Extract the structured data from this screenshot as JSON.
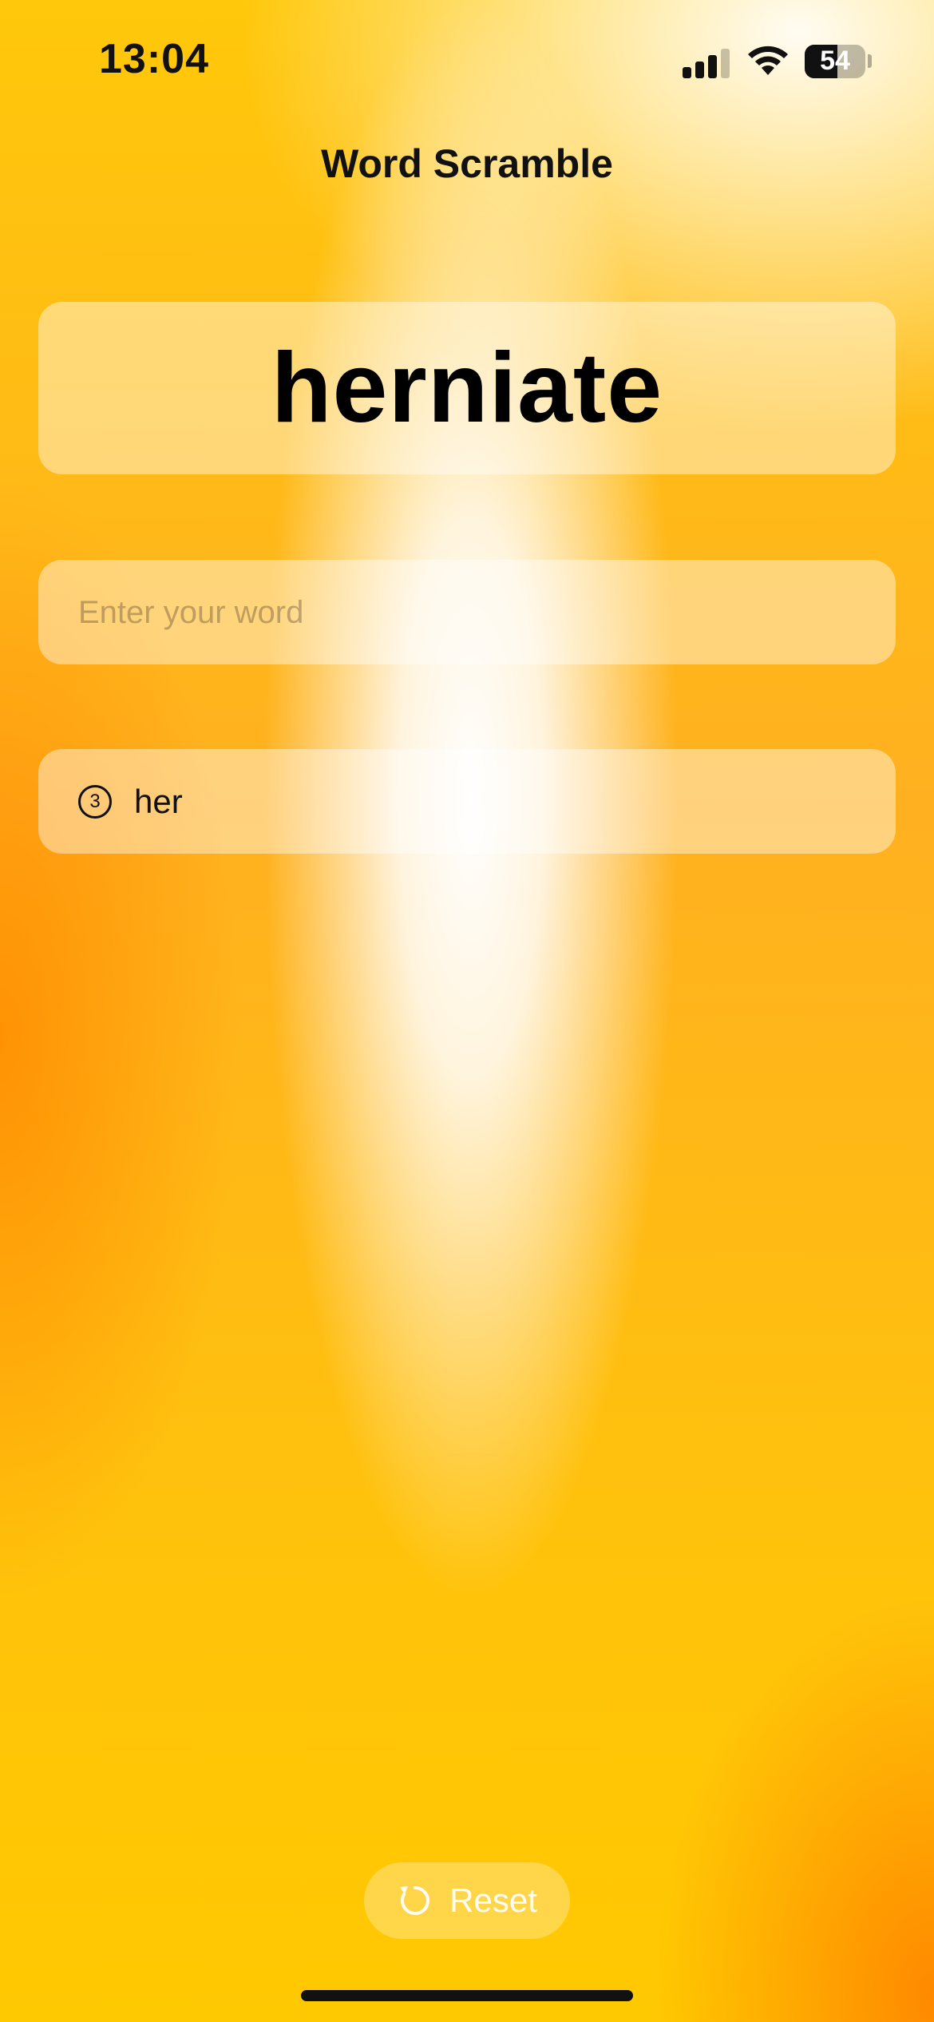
{
  "status_bar": {
    "time": "13:04",
    "battery_level": "54",
    "signal_icon": "cellular-signal-icon",
    "wifi_icon": "wifi-icon",
    "battery_icon": "battery-icon"
  },
  "nav": {
    "title": "Word Scramble"
  },
  "root_word": "herniate",
  "input": {
    "value": "",
    "placeholder": "Enter your word"
  },
  "used_words": [
    {
      "count": "3",
      "word": "her",
      "icon": "circled-number-icon"
    }
  ],
  "reset": {
    "label": "Reset",
    "icon": "reset-arrow-icon"
  },
  "colors": {
    "accent_yellow": "#ffc900",
    "accent_orange": "#ff9500",
    "text": "#111111"
  }
}
